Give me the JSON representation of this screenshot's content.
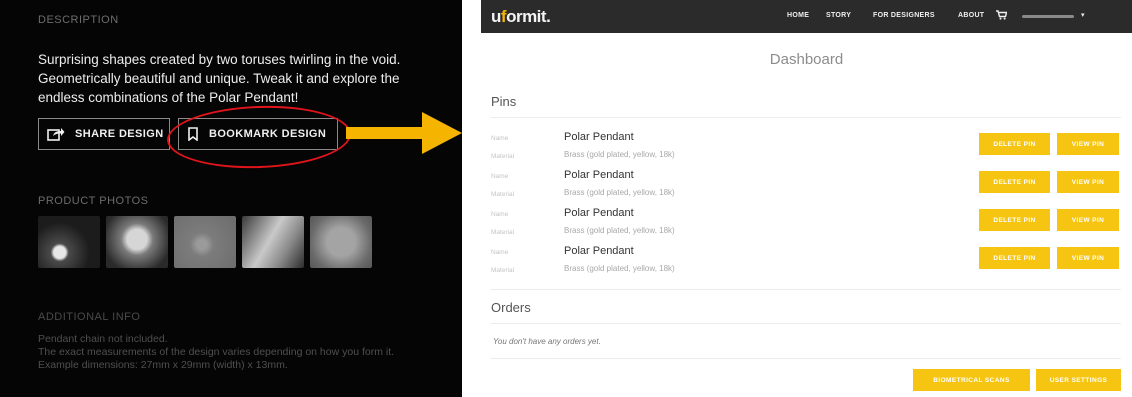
{
  "left_panel": {
    "description_heading": "DESCRIPTION",
    "description_lines": [
      "Surprising shapes created by two toruses twirling in the void.",
      "Geometrically beautiful and unique. Tweak it and explore the",
      "endless combinations of the Polar Pendant!"
    ],
    "share_label": "SHARE DESIGN",
    "bookmark_label": "BOOKMARK DESIGN",
    "photos_heading": "PRODUCT PHOTOS",
    "additional_heading": "ADDITIONAL INFO",
    "info_lines": [
      "Pendant chain not included.",
      "The exact measurements of the design varies depending on how you form it.",
      "Example dimensions: 27mm x 29mm (width) x 13mm."
    ],
    "highlight_color": "#e0141b"
  },
  "annotation": {
    "arrow_color": "#f4b400"
  },
  "app": {
    "logo": {
      "prefix": "u",
      "accent": "f",
      "rest": "ormit."
    },
    "nav": [
      "HOME",
      "STORY",
      "FOR DESIGNERS",
      "ABOUT"
    ],
    "page_title": "Dashboard",
    "pins_heading": "Pins",
    "field_labels": {
      "name": "Name",
      "material": "Material"
    },
    "pins": [
      {
        "name": "Polar Pendant",
        "material": "Brass (gold plated, yellow, 18k)",
        "delete": "DELETE PIN",
        "view": "VIEW PIN"
      },
      {
        "name": "Polar Pendant",
        "material": "Brass (gold plated, yellow, 18k)",
        "delete": "DELETE PIN",
        "view": "VIEW PIN"
      },
      {
        "name": "Polar Pendant",
        "material": "Brass (gold plated, yellow, 18k)",
        "delete": "DELETE PIN",
        "view": "VIEW PIN"
      },
      {
        "name": "Polar Pendant",
        "material": "Brass (gold plated, yellow, 18k)",
        "delete": "DELETE PIN",
        "view": "VIEW PIN"
      }
    ],
    "orders_heading": "Orders",
    "no_orders": "You don't have any orders yet.",
    "buttons": {
      "biometrical": "BIOMETRICAL SCANS",
      "settings": "USER SETTINGS"
    },
    "accent_color": "#f6c512"
  }
}
